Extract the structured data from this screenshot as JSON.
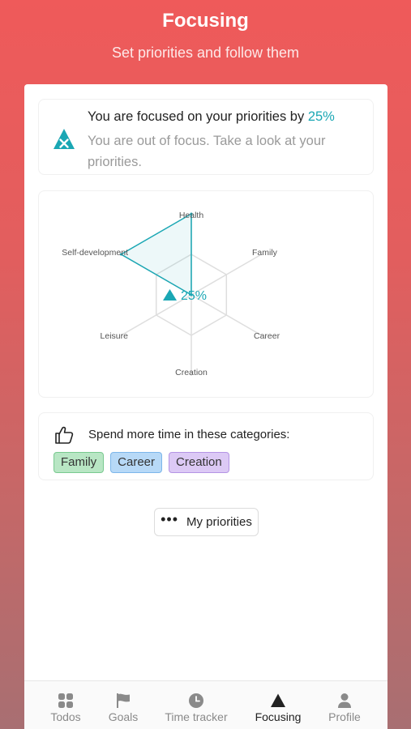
{
  "header": {
    "title": "Focusing",
    "subtitle": "Set priorities and follow them"
  },
  "focus": {
    "line1_prefix": "You are focused on your priorities by ",
    "percent": "25%",
    "message": "You are out of focus. Take a look at your priorities.",
    "icon": "focus-warning-icon",
    "accent_color": "#1aa7b4"
  },
  "radar": {
    "center_label": "25%",
    "axes": [
      "Health",
      "Family",
      "Career",
      "Creation",
      "Leisure",
      "Self-development"
    ]
  },
  "chart_data": {
    "type": "radar",
    "categories": [
      "Health",
      "Family",
      "Career",
      "Creation",
      "Leisure",
      "Self-development"
    ],
    "series": [
      {
        "values": [
          1.0,
          0.0,
          0.0,
          0.0,
          0.0,
          1.0
        ]
      }
    ],
    "center_value": "25%",
    "color": "#1aa7b4"
  },
  "categories_card": {
    "title": "Spend more time in these categories:",
    "icon": "thumbs-up-icon",
    "chips": [
      {
        "label": "Family",
        "color": "#b8e6c4"
      },
      {
        "label": "Career",
        "color": "#b7d9f7"
      },
      {
        "label": "Creation",
        "color": "#dcc9f5"
      }
    ]
  },
  "priorities_button": {
    "label": "My priorities",
    "icon": "more-dots-icon"
  },
  "tabbar": {
    "items": [
      {
        "label": "Todos",
        "icon": "grid-icon",
        "active": false
      },
      {
        "label": "Goals",
        "icon": "flag-icon",
        "active": false
      },
      {
        "label": "Time tracker",
        "icon": "clock-icon",
        "active": false
      },
      {
        "label": "Focusing",
        "icon": "triangle-icon",
        "active": true
      },
      {
        "label": "Profile",
        "icon": "person-icon",
        "active": false
      }
    ]
  }
}
